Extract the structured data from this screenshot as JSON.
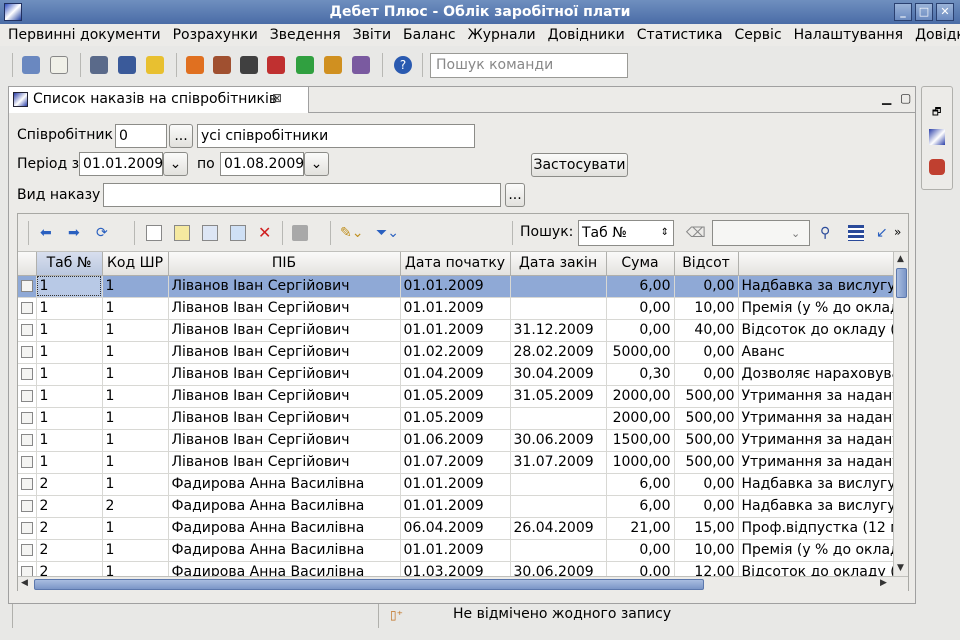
{
  "window": {
    "title": "Дебет Плюс - Облік заробітної плати"
  },
  "menu": [
    "Первинні документи",
    "Розрахунки",
    "Зведення",
    "Звіти",
    "Баланс",
    "Журнали",
    "Довідники",
    "Статистика",
    "Сервіс",
    "Налаштування",
    "Довідка"
  ],
  "toolbar": {
    "search_placeholder": "Пошук команди"
  },
  "tab": {
    "title": "Список наказів на співробітників"
  },
  "filters": {
    "employee_label": "Співробітник",
    "employee_code": "0",
    "employee_name": "усі співробітники",
    "period_label": "Період з",
    "period_from": "01.01.2009",
    "period_to_label": "по",
    "period_to": "01.08.2009",
    "apply_button": "Застосувати",
    "order_type_label": "Вид наказу",
    "order_type_value": "",
    "browse_button": "..."
  },
  "grid_toolbar": {
    "search_label": "Пошук:",
    "search_field": "Таб №",
    "search_value": ""
  },
  "table": {
    "columns": [
      "",
      "Таб №",
      "Код ШР",
      "ПІБ",
      "Дата початку",
      "Дата закін",
      "Сума",
      "Відсот",
      ""
    ],
    "rows": [
      [
        "1",
        "1",
        "Ліванов Іван Сергійович",
        "01.01.2009",
        "",
        "6,00",
        "0,00",
        "Надбавка за вислугу"
      ],
      [
        "1",
        "1",
        "Ліванов Іван Сергійович",
        "01.01.2009",
        "",
        "0,00",
        "10,00",
        "Премія (у % до оклад"
      ],
      [
        "1",
        "1",
        "Ліванов Іван Сергійович",
        "01.01.2009",
        "31.12.2009",
        "0,00",
        "40,00",
        "Відсоток до окладу (з"
      ],
      [
        "1",
        "1",
        "Ліванов Іван Сергійович",
        "01.02.2009",
        "28.02.2009",
        "5000,00",
        "0,00",
        "Аванс"
      ],
      [
        "1",
        "1",
        "Ліванов Іван Сергійович",
        "01.04.2009",
        "30.04.2009",
        "0,30",
        "0,00",
        "Дозволяє нараховува"
      ],
      [
        "1",
        "1",
        "Ліванов Іван Сергійович",
        "01.05.2009",
        "31.05.2009",
        "2000,00",
        "500,00",
        "Утримання за надану"
      ],
      [
        "1",
        "1",
        "Ліванов Іван Сергійович",
        "01.05.2009",
        "",
        "2000,00",
        "500,00",
        "Утримання за надану"
      ],
      [
        "1",
        "1",
        "Ліванов Іван Сергійович",
        "01.06.2009",
        "30.06.2009",
        "1500,00",
        "500,00",
        "Утримання за надану"
      ],
      [
        "1",
        "1",
        "Ліванов Іван Сергійович",
        "01.07.2009",
        "31.07.2009",
        "1000,00",
        "500,00",
        "Утримання за надану"
      ],
      [
        "2",
        "1",
        "Фадирова Анна Василівна",
        "01.01.2009",
        "",
        "6,00",
        "0,00",
        "Надбавка за вислугу"
      ],
      [
        "2",
        "2",
        "Фадирова Анна Василівна",
        "01.01.2009",
        "",
        "6,00",
        "0,00",
        "Надбавка за вислугу"
      ],
      [
        "2",
        "1",
        "Фадирова Анна Василівна",
        "06.04.2009",
        "26.04.2009",
        "21,00",
        "15,00",
        "Проф.відпустка (12 м"
      ],
      [
        "2",
        "1",
        "Фадирова Анна Василівна",
        "01.01.2009",
        "",
        "0,00",
        "10,00",
        "Премія (у % до оклад"
      ],
      [
        "2",
        "1",
        "Фадирова Анна Василівна",
        "01.03.2009",
        "30.06.2009",
        "0,00",
        "12,00",
        "Відсоток до окладу (з"
      ]
    ]
  },
  "status": {
    "message": "Не відмічено жодного запису"
  },
  "colors": {
    "titlebar": "#5a7cb4",
    "selection": "#8fa9d6"
  }
}
